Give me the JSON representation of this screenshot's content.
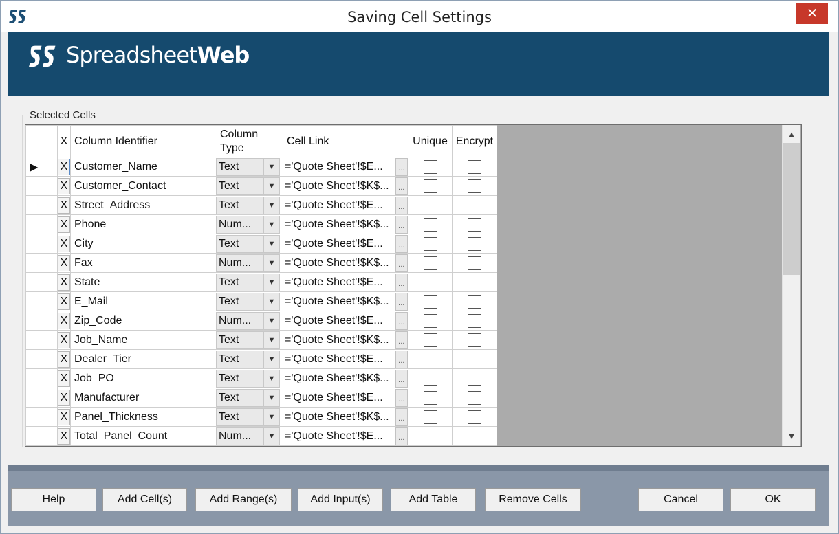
{
  "window": {
    "title": "Saving Cell Settings",
    "close_glyph": "✕"
  },
  "brand": {
    "name_light": "Spreadsheet",
    "name_bold": "Web",
    "banner_color": "#154a6e"
  },
  "group": {
    "label": "Selected Cells"
  },
  "grid": {
    "headers": {
      "x": "X",
      "column_identifier": "Column Identifier",
      "column_type_line1": "Column",
      "column_type_line2": "Type",
      "cell_link": "Cell Link",
      "unique": "Unique",
      "encrypt": "Encrypt"
    },
    "current_row_indicator": "▶",
    "rows": [
      {
        "x": "X",
        "id": "Customer_Name",
        "type": "Text",
        "link": "='Quote Sheet'!$E...",
        "more": "...",
        "unique": false,
        "encrypt": false
      },
      {
        "x": "X",
        "id": "Customer_Contact",
        "type": "Text",
        "link": "='Quote Sheet'!$K$...",
        "more": "...",
        "unique": false,
        "encrypt": false
      },
      {
        "x": "X",
        "id": "Street_Address",
        "type": "Text",
        "link": "='Quote Sheet'!$E...",
        "more": "...",
        "unique": false,
        "encrypt": false
      },
      {
        "x": "X",
        "id": "Phone",
        "type": "Num...",
        "link": "='Quote Sheet'!$K$...",
        "more": "...",
        "unique": false,
        "encrypt": false
      },
      {
        "x": "X",
        "id": "City",
        "type": "Text",
        "link": "='Quote Sheet'!$E...",
        "more": "...",
        "unique": false,
        "encrypt": false
      },
      {
        "x": "X",
        "id": "Fax",
        "type": "Num...",
        "link": "='Quote Sheet'!$K$...",
        "more": "...",
        "unique": false,
        "encrypt": false
      },
      {
        "x": "X",
        "id": "State",
        "type": "Text",
        "link": "='Quote Sheet'!$E...",
        "more": "...",
        "unique": false,
        "encrypt": false
      },
      {
        "x": "X",
        "id": "E_Mail",
        "type": "Text",
        "link": "='Quote Sheet'!$K$...",
        "more": "...",
        "unique": false,
        "encrypt": false
      },
      {
        "x": "X",
        "id": "Zip_Code",
        "type": "Num...",
        "link": "='Quote Sheet'!$E...",
        "more": "...",
        "unique": false,
        "encrypt": false
      },
      {
        "x": "X",
        "id": "Job_Name",
        "type": "Text",
        "link": "='Quote Sheet'!$K$...",
        "more": "...",
        "unique": false,
        "encrypt": false
      },
      {
        "x": "X",
        "id": "Dealer_Tier",
        "type": "Text",
        "link": "='Quote Sheet'!$E...",
        "more": "...",
        "unique": false,
        "encrypt": false
      },
      {
        "x": "X",
        "id": "Job_PO",
        "type": "Text",
        "link": "='Quote Sheet'!$K$...",
        "more": "...",
        "unique": false,
        "encrypt": false
      },
      {
        "x": "X",
        "id": "Manufacturer",
        "type": "Text",
        "link": "='Quote Sheet'!$E...",
        "more": "...",
        "unique": false,
        "encrypt": false
      },
      {
        "x": "X",
        "id": "Panel_Thickness",
        "type": "Text",
        "link": "='Quote Sheet'!$K$...",
        "more": "...",
        "unique": false,
        "encrypt": false
      },
      {
        "x": "X",
        "id": "Total_Panel_Count",
        "type": "Num...",
        "link": "='Quote Sheet'!$E...",
        "more": "...",
        "unique": false,
        "encrypt": false
      }
    ]
  },
  "buttons": {
    "help": "Help",
    "add_cells": "Add Cell(s)",
    "add_ranges": "Add Range(s)",
    "add_inputs": "Add Input(s)",
    "add_table": "Add Table",
    "remove_cells": "Remove Cells",
    "cancel": "Cancel",
    "ok": "OK"
  },
  "icons": {
    "app": "spreadsheetweb-logo-icon",
    "close": "close-icon",
    "dropdown": "chevron-down-icon",
    "scroll_up": "chevron-up-icon",
    "scroll_down": "chevron-down-icon",
    "row_pointer": "triangle-right-icon"
  },
  "scroll_glyphs": {
    "up": "▲",
    "down": "▼"
  },
  "dropdown_glyph": "▼"
}
